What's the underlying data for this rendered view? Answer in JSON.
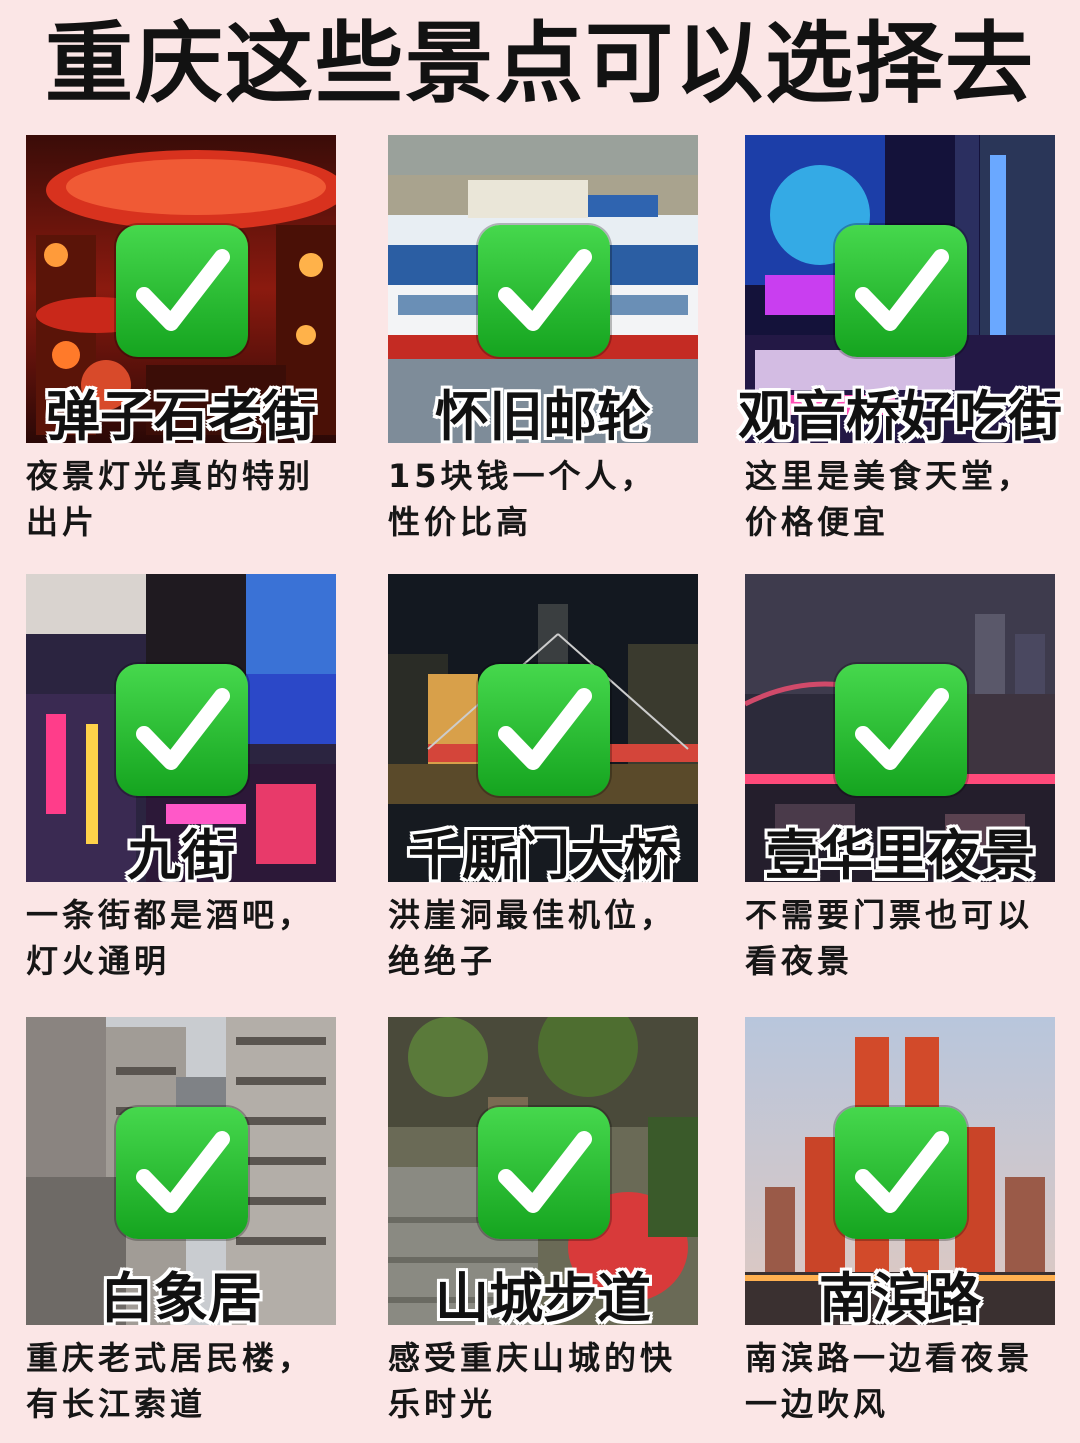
{
  "title": "重庆这些景点可以选择去",
  "spots": [
    {
      "name": "弹子石老街",
      "desc": "夜景灯光真的特别出片",
      "icon": "check-mark-icon"
    },
    {
      "name": "怀旧邮轮",
      "desc": "15块钱一个人，性价比高",
      "icon": "check-mark-icon"
    },
    {
      "name": "观音桥好吃街",
      "desc": "这里是美食天堂，价格便宜",
      "icon": "check-mark-icon"
    },
    {
      "name": "九街",
      "desc": "一条街都是酒吧，灯火通明",
      "icon": "check-mark-icon"
    },
    {
      "name": "千厮门大桥",
      "desc": "洪崖洞最佳机位，绝绝子",
      "icon": "check-mark-icon"
    },
    {
      "name": "壹华里夜景",
      "desc": "不需要门票也可以看夜景",
      "icon": "check-mark-icon"
    },
    {
      "name": "白象居",
      "desc": "重庆老式居民楼，有长江索道",
      "icon": "check-mark-icon"
    },
    {
      "name": "山城步道",
      "desc": "感受重庆山城的快乐时光",
      "icon": "check-mark-icon"
    },
    {
      "name": "南滨路",
      "desc": "南滨路一边看夜景一边吹风",
      "icon": "check-mark-icon"
    }
  ],
  "colors": {
    "background": "#fbe6e6",
    "check_green": "#2cc233",
    "title_text": "#121212"
  }
}
